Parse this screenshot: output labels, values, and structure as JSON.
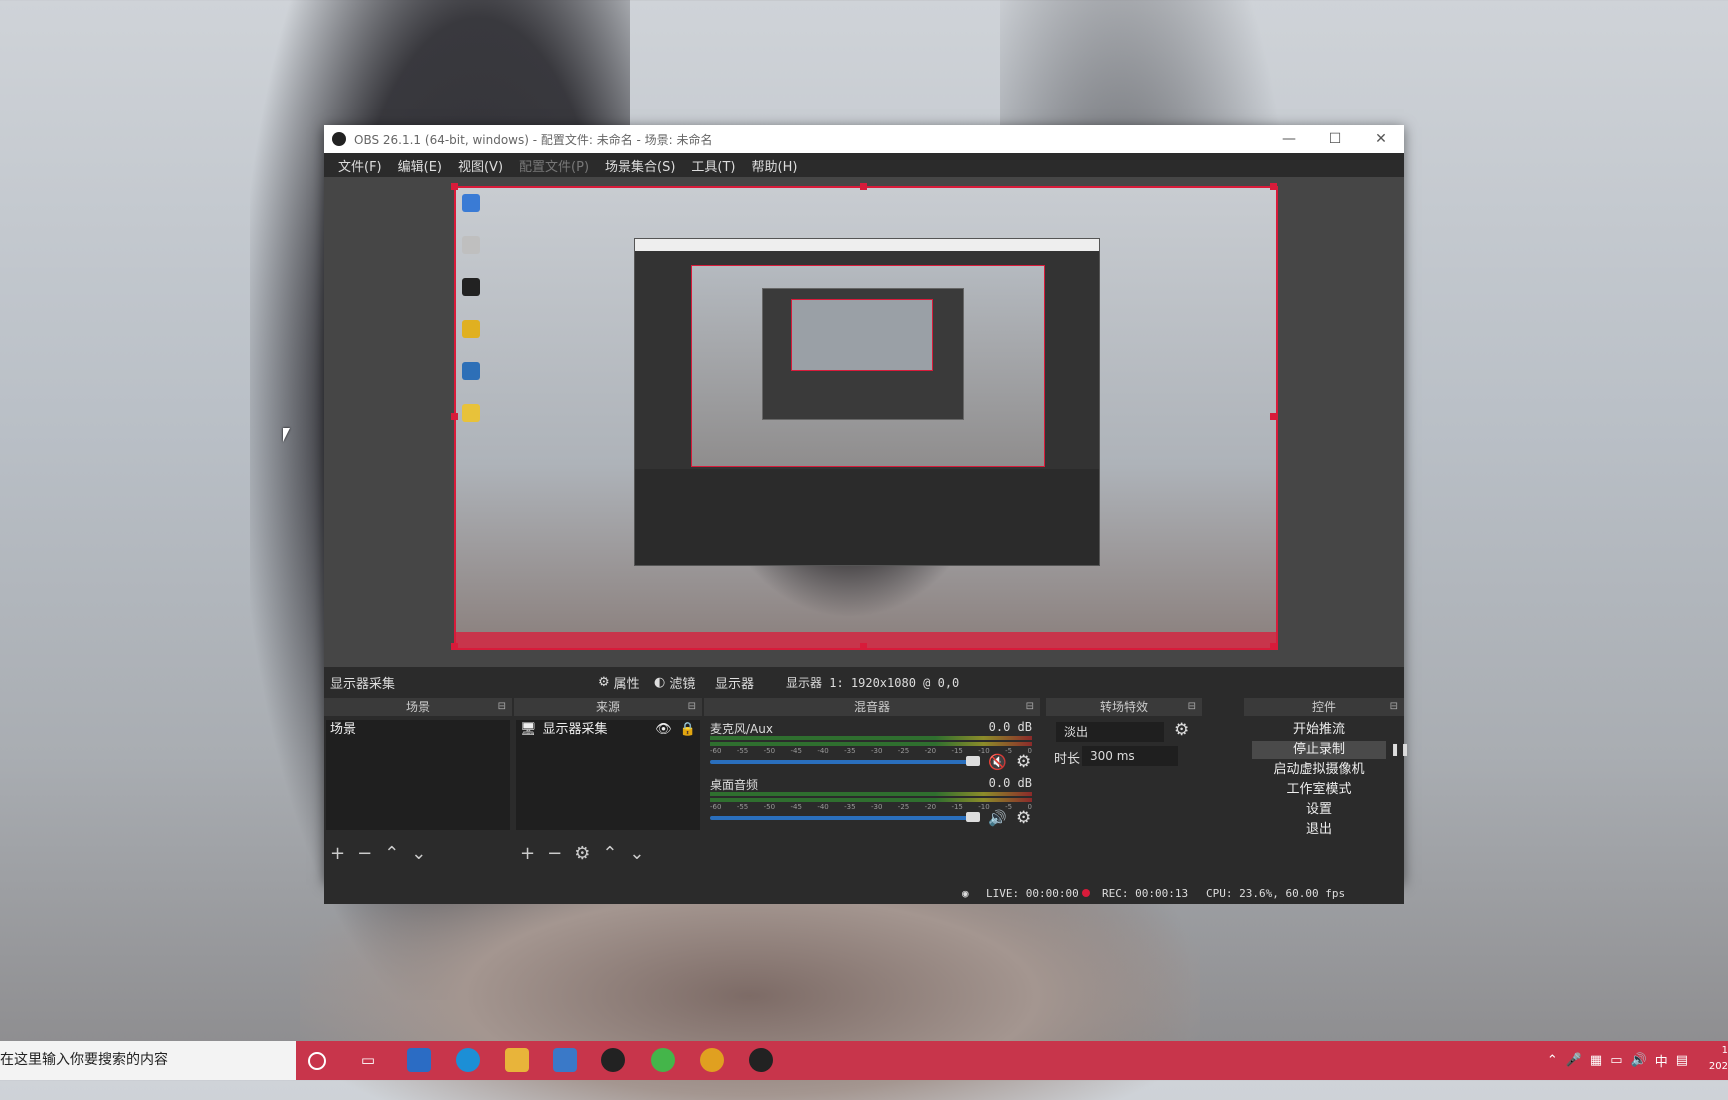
{
  "window": {
    "title": "OBS 26.1.1 (64-bit, windows) - 配置文件: 未命名 - 场景: 未命名",
    "controls": [
      "—",
      "☐",
      "✕"
    ]
  },
  "menu": [
    {
      "label": "文件(F)",
      "disabled": false
    },
    {
      "label": "编辑(E)",
      "disabled": false
    },
    {
      "label": "视图(V)",
      "disabled": false
    },
    {
      "label": "配置文件(P)",
      "disabled": true
    },
    {
      "label": "场景集合(S)",
      "disabled": false
    },
    {
      "label": "工具(T)",
      "disabled": false
    },
    {
      "label": "帮助(H)",
      "disabled": false
    }
  ],
  "source_toolbar": {
    "source_name": "显示器采集",
    "properties": "属性",
    "filters": "滤镜",
    "display_label": "显示器",
    "display_value": "显示器 1: 1920x1080 @ 0,0"
  },
  "docks": {
    "scenes": {
      "title": "场景",
      "items": [
        "场景"
      ]
    },
    "sources": {
      "title": "来源",
      "items": [
        "显示器采集"
      ]
    },
    "mixer": {
      "title": "混音器",
      "channels": [
        {
          "name": "麦克风/Aux",
          "db": "0.0 dB"
        },
        {
          "name": "桌面音频",
          "db": "0.0 dB"
        }
      ],
      "ticks": [
        "-60",
        "-55",
        "-50",
        "-45",
        "-40",
        "-35",
        "-30",
        "-25",
        "-20",
        "-15",
        "-10",
        "-5",
        "0"
      ]
    },
    "transitions": {
      "title": "转场特效",
      "selected": "淡出",
      "duration_label": "时长",
      "duration_value": "300 ms"
    },
    "controls": {
      "title": "控件",
      "buttons": [
        "开始推流",
        "停止录制",
        "启动虚拟摄像机",
        "工作室模式",
        "设置",
        "退出"
      ]
    }
  },
  "status": {
    "live": "LIVE: 00:00:00",
    "rec": "REC: 00:00:13",
    "cpu": "CPU: 23.6%, 60.00 fps"
  },
  "taskbar": {
    "search_placeholder": "在这里输入你要搜索的内容",
    "ime": "中",
    "clock_line1": "1",
    "clock_line2": "202"
  },
  "colors": {
    "accent_red": "#d81b3a",
    "taskbar": "#c8354b",
    "panel": "#2b2b2b"
  }
}
